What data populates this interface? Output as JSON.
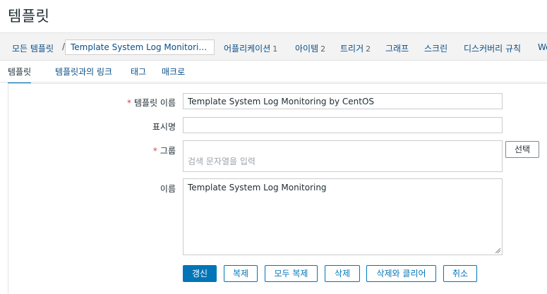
{
  "title": "템플릿",
  "breadcrumb": {
    "all_templates": "모든 템플릿",
    "separator": "/",
    "current": "Template System Log Monitoring b...",
    "items": [
      {
        "label": "어플리케이션",
        "count": "1"
      },
      {
        "label": "아이템",
        "count": "2"
      },
      {
        "label": "트리거",
        "count": "2"
      },
      {
        "label": "그래프",
        "count": ""
      },
      {
        "label": "스크린",
        "count": ""
      },
      {
        "label": "디스커버리 규칙",
        "count": ""
      },
      {
        "label": "We",
        "count": ""
      }
    ]
  },
  "tabs": [
    {
      "label": "템플릿",
      "active": true
    },
    {
      "label": "템플릿과의 링크",
      "active": false
    },
    {
      "label": "태그",
      "active": false
    },
    {
      "label": "매크로",
      "active": false
    }
  ],
  "form": {
    "template_name": {
      "label": "템플릿 이름",
      "required": "*",
      "value": "Template System Log Monitoring by CentOS"
    },
    "visible_name": {
      "label": "표시명",
      "value": ""
    },
    "groups": {
      "label": "그룹",
      "required": "*",
      "placeholder": "검색 문자열을 입력",
      "select_button": "선택"
    },
    "description": {
      "label": "이름",
      "value": "Template System Log Monitoring"
    }
  },
  "actions": {
    "update": "갱신",
    "clone": "복제",
    "full_clone": "모두 복제",
    "delete": "삭제",
    "delete_and_clear": "삭제와 클리어",
    "cancel": "취소"
  },
  "colors": {
    "link": "#0a4e88",
    "accent": "#0275b8",
    "required": "#d54545"
  }
}
